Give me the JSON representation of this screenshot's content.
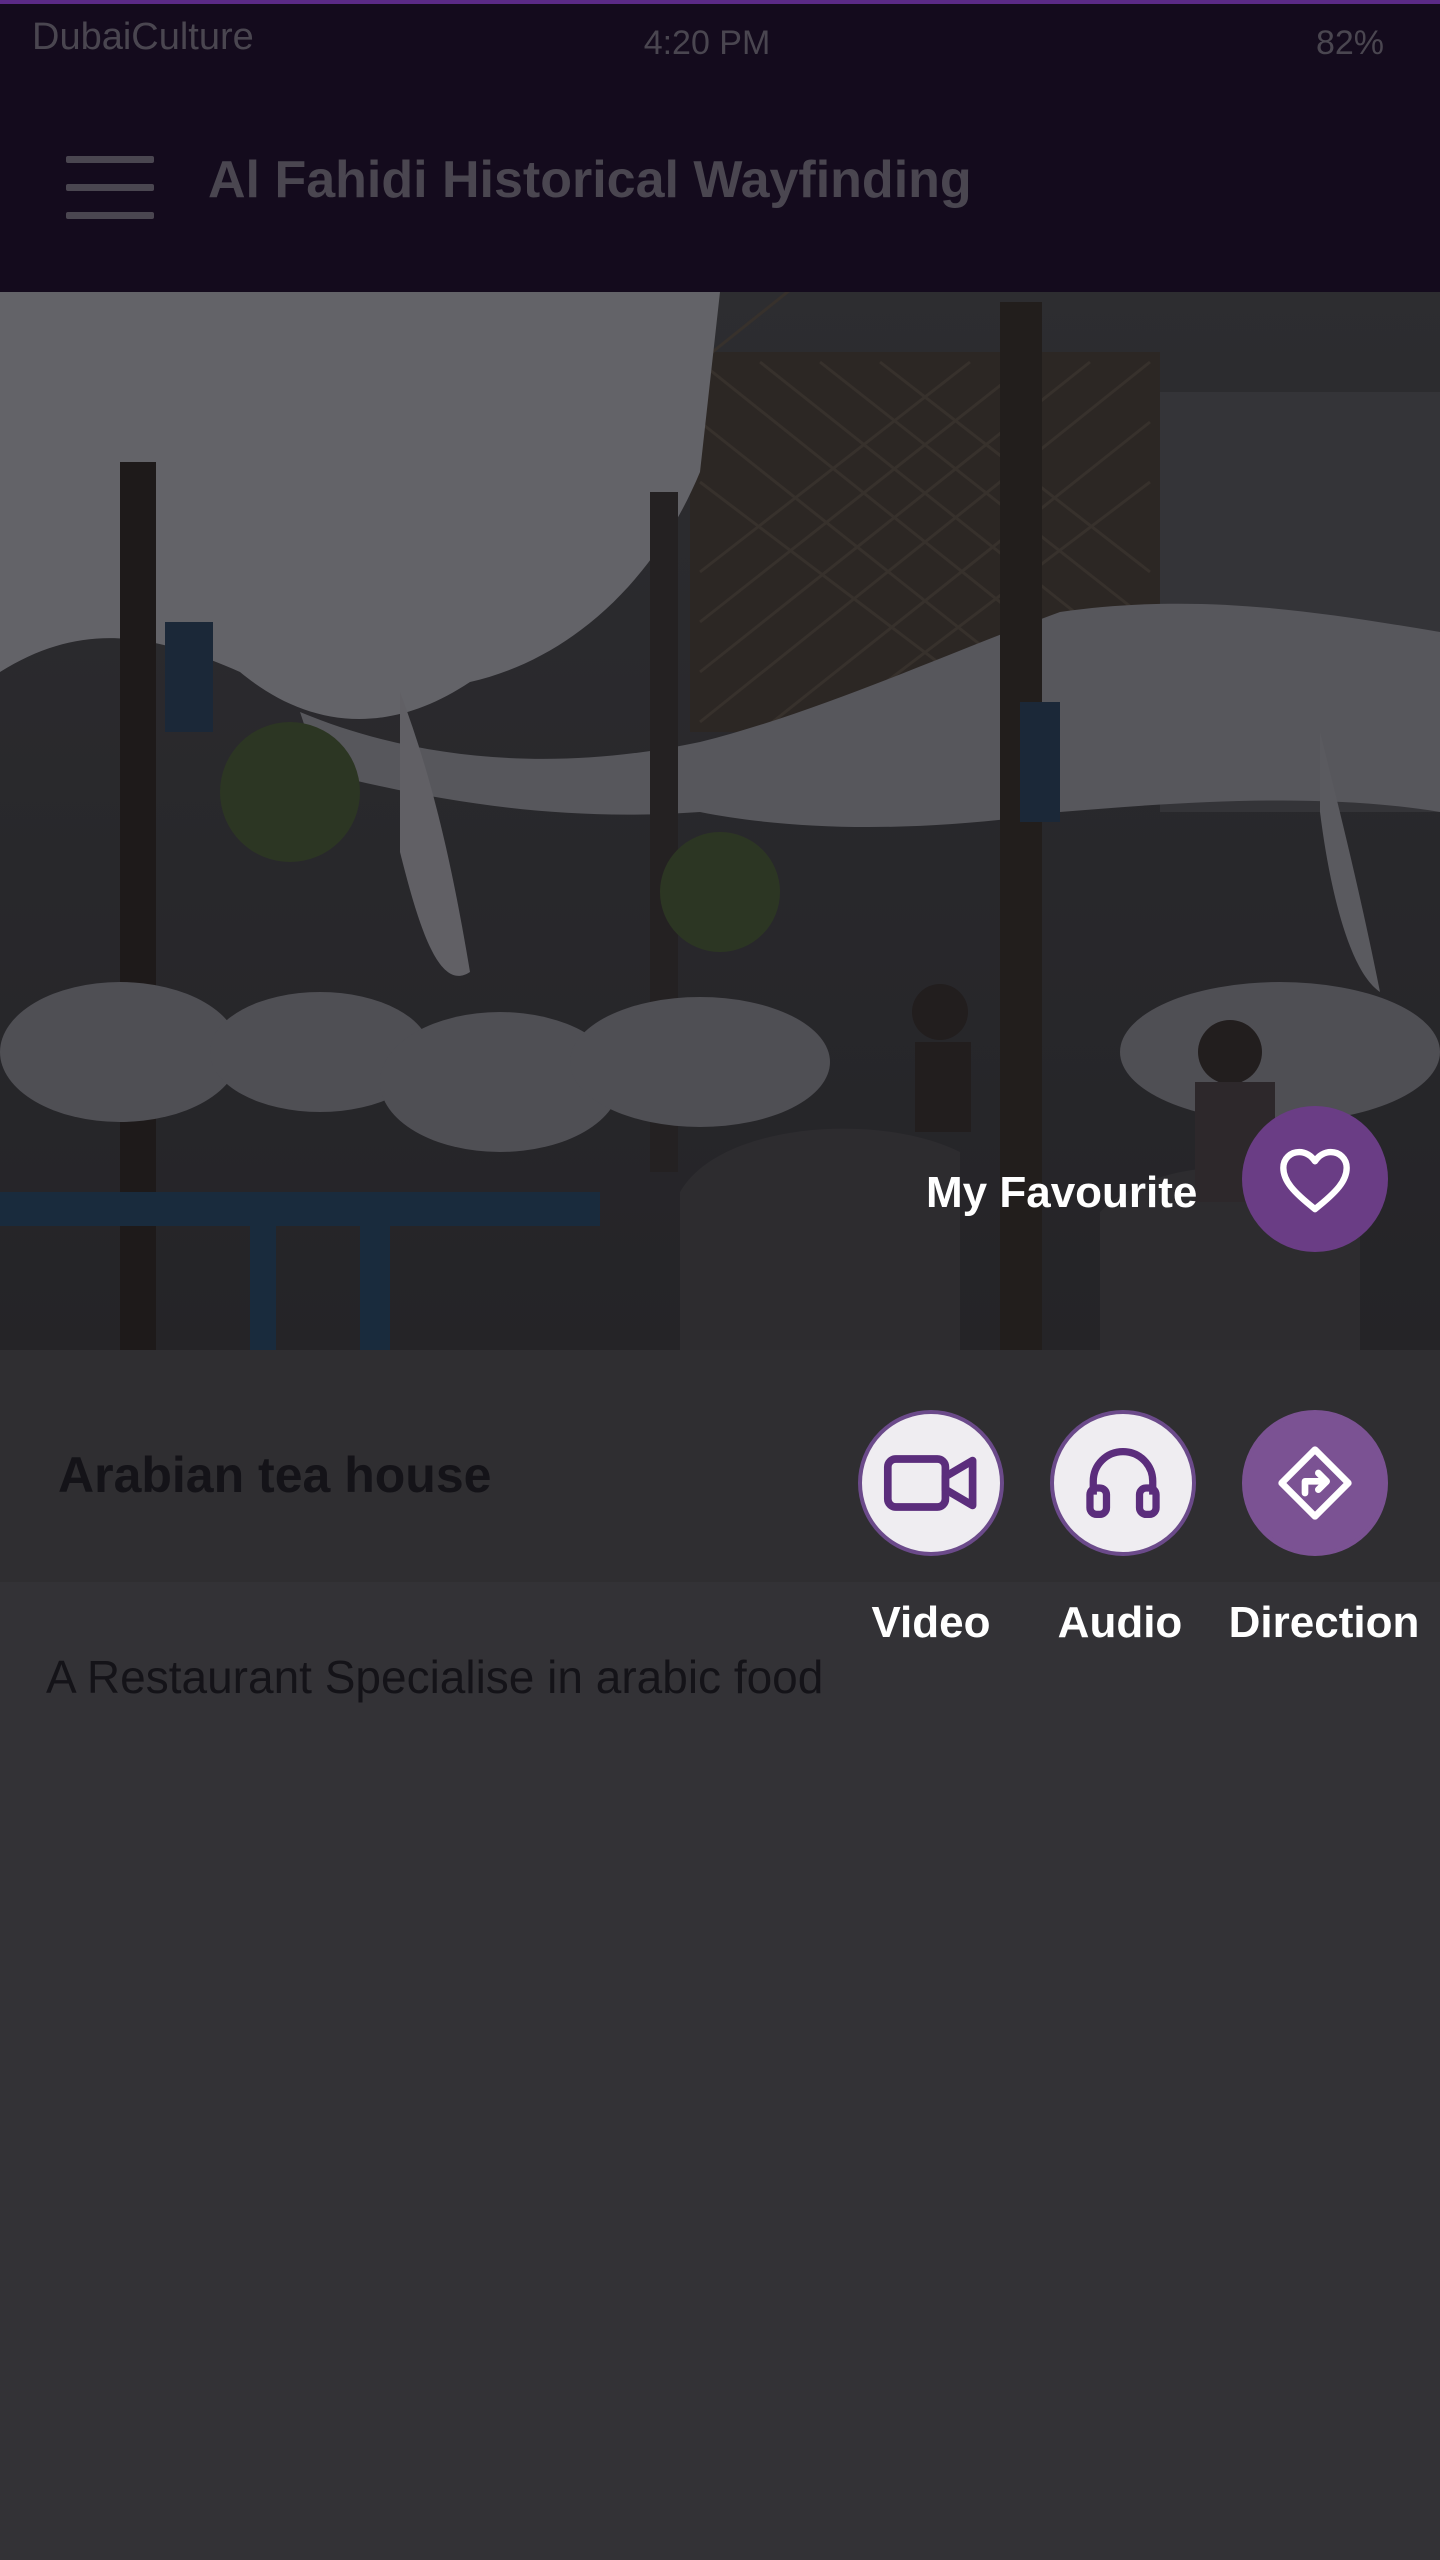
{
  "status_bar": {
    "carrier": "DubaiCulture",
    "time": "4:20 PM",
    "battery": "82%"
  },
  "app_bar": {
    "title": "Al Fahidi Historical Wayfinding",
    "menu_icon": "hamburger-menu-icon"
  },
  "hero": {
    "description": "Photo of outdoor seating area with white fabric canopies"
  },
  "favourite": {
    "label": "My Favourite",
    "icon": "heart-icon"
  },
  "place": {
    "title": "Arabian tea house",
    "description": "A Restaurant Specialise in arabic food"
  },
  "actions": [
    {
      "label": "Video",
      "icon": "video-camera-icon"
    },
    {
      "label": "Audio",
      "icon": "headphones-icon"
    },
    {
      "label": "Direction",
      "icon": "direction-sign-icon"
    }
  ],
  "colors": {
    "accent": "#6a3d85",
    "appbar_bg": "#140b1d",
    "page_bg": "#333236"
  }
}
